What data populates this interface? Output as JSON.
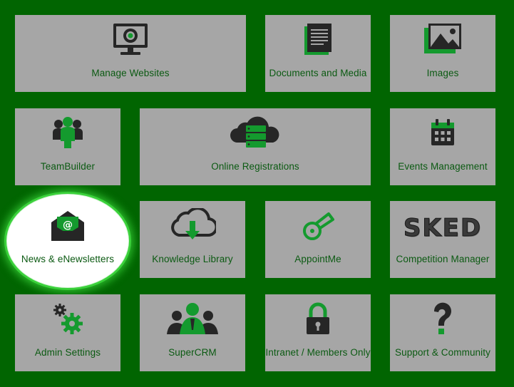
{
  "colors": {
    "background": "#016501",
    "tile": "#a6a6a6",
    "label": "#0b5a12",
    "icon_dark": "#262626",
    "icon_green": "#149a2e",
    "highlight": "#ffffff"
  },
  "tiles": [
    {
      "label": "Manage Websites",
      "icon": "monitor-icon"
    },
    {
      "label": "Documents and Media",
      "icon": "document-icon"
    },
    {
      "label": "Images",
      "icon": "image-icon"
    },
    {
      "label": "TeamBuilder",
      "icon": "team-icon"
    },
    {
      "label": "Online Registrations",
      "icon": "cloud-server-icon"
    },
    {
      "label": "Events Management",
      "icon": "calendar-icon"
    },
    {
      "label": "News & eNewsletters",
      "icon": "envelope-icon",
      "selected": true
    },
    {
      "label": "Knowledge Library",
      "icon": "cloud-download-icon"
    },
    {
      "label": "AppointMe",
      "icon": "whistle-icon"
    },
    {
      "label": "Competition Manager",
      "icon": "sked-logo-icon",
      "logo_text": "SKED"
    },
    {
      "label": "Admin Settings",
      "icon": "gears-icon"
    },
    {
      "label": "SuperCRM",
      "icon": "people-icon"
    },
    {
      "label": "Intranet / Members Only",
      "icon": "lock-icon"
    },
    {
      "label": "Support & Community",
      "icon": "question-icon"
    }
  ]
}
